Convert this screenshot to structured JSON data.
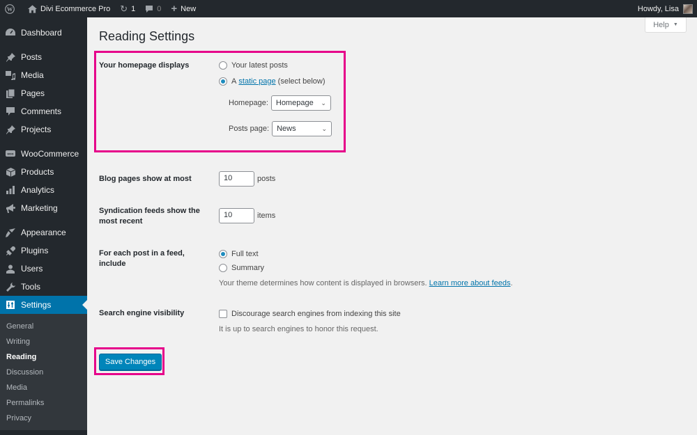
{
  "adminbar": {
    "wp_logo": "wordpress-icon",
    "site_name": "Divi Ecommerce Pro",
    "updates_count": "1",
    "comments_count": "0",
    "new_label": "New",
    "greeting": "Howdy, Lisa"
  },
  "sidebar": {
    "items": [
      {
        "label": "Dashboard",
        "icon": "dashboard-icon"
      },
      {
        "label": "Posts",
        "icon": "pin-icon"
      },
      {
        "label": "Media",
        "icon": "media-icon"
      },
      {
        "label": "Pages",
        "icon": "pages-icon"
      },
      {
        "label": "Comments",
        "icon": "comment-icon"
      },
      {
        "label": "Projects",
        "icon": "pin-icon"
      },
      {
        "label": "WooCommerce",
        "icon": "woo-icon"
      },
      {
        "label": "Products",
        "icon": "box-icon"
      },
      {
        "label": "Analytics",
        "icon": "bar-chart-icon"
      },
      {
        "label": "Marketing",
        "icon": "megaphone-icon"
      },
      {
        "label": "Appearance",
        "icon": "brush-icon"
      },
      {
        "label": "Plugins",
        "icon": "plug-icon"
      },
      {
        "label": "Users",
        "icon": "user-icon"
      },
      {
        "label": "Tools",
        "icon": "wrench-icon"
      },
      {
        "label": "Settings",
        "icon": "settings-icon"
      }
    ],
    "submenu": [
      "General",
      "Writing",
      "Reading",
      "Discussion",
      "Media",
      "Permalinks",
      "Privacy"
    ],
    "current_submenu": "Reading"
  },
  "main": {
    "help_label": "Help",
    "title": "Reading Settings",
    "homepage_displays": {
      "label": "Your homepage displays",
      "option_latest": "Your latest posts",
      "option_static_prefix": "A",
      "option_static_link": "static page",
      "option_static_suffix": "(select below)",
      "selected": "static",
      "homepage_label": "Homepage:",
      "homepage_value": "Homepage",
      "posts_page_label": "Posts page:",
      "posts_page_value": "News"
    },
    "blog_pages": {
      "label": "Blog pages show at most",
      "value": "10",
      "unit": "posts"
    },
    "syndication": {
      "label": "Syndication feeds show the most recent",
      "value": "10",
      "unit": "items"
    },
    "feed_include": {
      "label": "For each post in a feed, include",
      "option_full": "Full text",
      "option_summary": "Summary",
      "selected": "full",
      "description": "Your theme determines how content is displayed in browsers.",
      "link": "Learn more about feeds"
    },
    "search_visibility": {
      "label": "Search engine visibility",
      "checkbox_label": "Discourage search engines from indexing this site",
      "checked": false,
      "description": "It is up to search engines to honor this request."
    },
    "save_label": "Save Changes"
  },
  "colors": {
    "accent": "#0073aa",
    "highlight": "#e6008a",
    "adminbar_bg": "#23282d"
  }
}
